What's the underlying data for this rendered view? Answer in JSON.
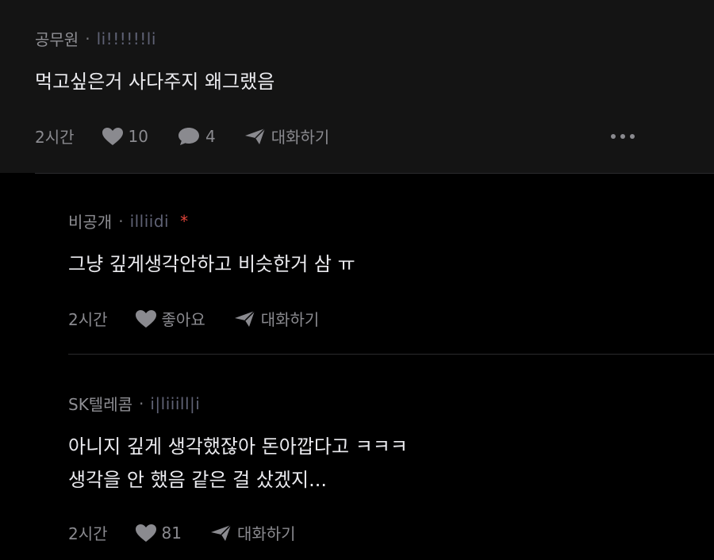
{
  "comments": [
    {
      "author": "공무원",
      "separator": "·",
      "nickname": "li!!!!!!li",
      "body": [
        "먹고싶은거 사다주지 왜그랬음"
      ],
      "time": "2시간",
      "likes": "10",
      "replies": "4",
      "chat_label": "대화하기"
    },
    {
      "author": "비공개",
      "separator": "·",
      "nickname": "illiidi",
      "marker": "*",
      "body": [
        "그냥 깊게생각안하고 비슷한거 삼 ㅠ"
      ],
      "time": "2시간",
      "likes": "좋아요",
      "chat_label": "대화하기"
    },
    {
      "author": "SK텔레콤",
      "separator": "·",
      "nickname": "i|liiill|i",
      "body": [
        "아니지 깊게 생각했잖아 돈아깝다고 ㅋㅋㅋ",
        "생각을 안 했음 같은 걸 샀겠지..."
      ],
      "time": "2시간",
      "likes": "81",
      "chat_label": "대화하기"
    }
  ],
  "icons": {
    "like": "heart-icon",
    "reply": "speech-bubble-icon",
    "chat": "paper-plane-icon",
    "more": "more-dots-icon"
  },
  "colors": {
    "background": "#000000",
    "highlighted_comment_bg": "#141414",
    "text": "#ebebef",
    "muted": "#8a8a8f",
    "nickname": "#5f6275",
    "marker": "#e0443a"
  }
}
